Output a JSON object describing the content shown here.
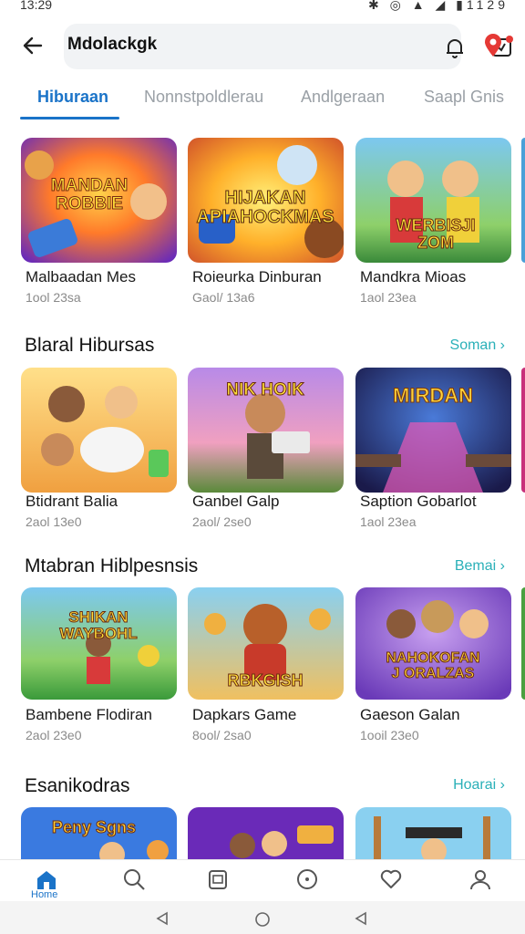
{
  "status": {
    "time": "13:29",
    "battery": "1129"
  },
  "header": {
    "query": "Mdolackgk",
    "back_icon": "arrow-left-icon",
    "bell_icon": "bell-icon",
    "calendar_icon": "calendar-icon",
    "pin_icon": "map-pin-icon"
  },
  "tabs": [
    {
      "label": "Hiburaan",
      "active": true
    },
    {
      "label": "Nonnstpoldlerau",
      "active": false
    },
    {
      "label": "Andlgeraan",
      "active": false
    },
    {
      "label": "Saapl Gnis",
      "active": false
    }
  ],
  "row1": [
    {
      "title": "Malbaadan Mes",
      "sub": "1ool 23sa",
      "art": "MANDAN\nROBBIE"
    },
    {
      "title": "Roieurka Dinburan",
      "sub": "Gaol/ 13a6",
      "art": "HIJAKAN\nAPIAHOCKMAS"
    },
    {
      "title": "Mandkra Mioas",
      "sub": "1aol 23ea",
      "art": "WERBISJI\nZOM"
    }
  ],
  "section2": {
    "title": "Blaral Hibursas",
    "see_all": "Soman"
  },
  "row2": [
    {
      "title": "Btidrant Balia",
      "sub": "2aol 13e0",
      "art": ""
    },
    {
      "title": "Ganbel Galp",
      "sub": "2aol/ 2se0",
      "art": "NIK HOIK"
    },
    {
      "title": "Saption Gobarlot",
      "sub": "1aol 23ea",
      "art": "MIRDAN"
    }
  ],
  "section3": {
    "title": "Mtabran Hiblpesnsis",
    "see_all": "Bemai"
  },
  "row3": [
    {
      "title": "Bambene Flodiran",
      "sub": "2aol 23e0",
      "art": "SHIKAN\nWAYBOHL"
    },
    {
      "title": "Dapkars Game",
      "sub": "8ool/ 2sa0",
      "art": "RBKGISH"
    },
    {
      "title": "Gaeson Galan",
      "sub": "1ooil 23e0",
      "art": "NAHOKOFAN\nJ ORALZAS"
    }
  ],
  "section4": {
    "title": "Esanikodras",
    "see_all": "Hoarai"
  },
  "row4": [
    {
      "art": "Peny Sgns"
    },
    {
      "art": ""
    },
    {
      "art": ""
    }
  ],
  "bottom_nav": {
    "home_label": "Home"
  },
  "colors": {
    "accent": "#1a73c8",
    "link": "#2ab0b8",
    "badge": "#e53935"
  }
}
